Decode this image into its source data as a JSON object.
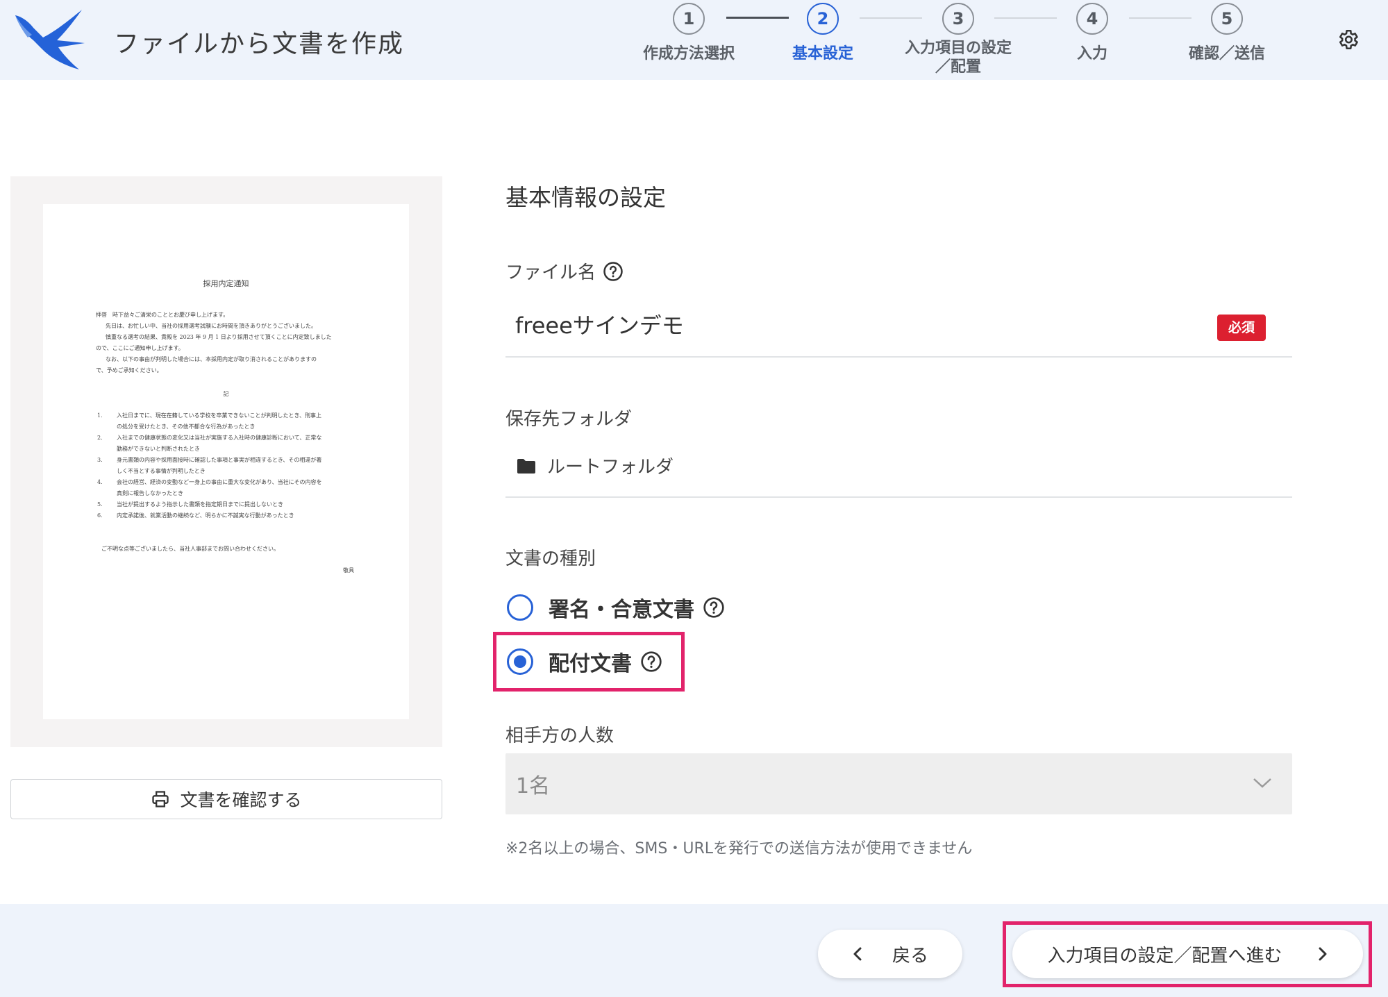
{
  "header": {
    "app_title": "ファイルから文書を作成",
    "steps": [
      {
        "number": "1",
        "label": "作成方法選択",
        "state": "done"
      },
      {
        "number": "2",
        "label": "基本設定",
        "state": "active"
      },
      {
        "number": "3",
        "label_line1": "入力項目の設定",
        "label_line2": "／配置",
        "state": "pending"
      },
      {
        "number": "4",
        "label": "入力",
        "state": "pending"
      },
      {
        "number": "5",
        "label": "確認／送信",
        "state": "pending"
      }
    ],
    "settings_icon": "gear-icon"
  },
  "preview": {
    "document": {
      "title": "採用内定通知",
      "body_lines": [
        "拝啓　時下益々ご清栄のこととお慶び申し上げます。",
        "先日は、お忙しい中、当社の採用選考試験にお時間を頂きありがとうございました。",
        "慎重なる選考の結果、貴殿を 2023 年 9 月 1 日より採用させて頂くことに内定致しました",
        "ので、ここにご通知申し上げます。",
        "なお、以下の事由が判明した場合には、本採用内定が取り消されることがありますの",
        "で、予めご承知ください。"
      ],
      "center_mark": "記",
      "items": [
        {
          "num": "1.",
          "lines": [
            "入社日までに、現在在籍している学校を卒業できないことが判明したとき、刑事上",
            "の処分を受けたとき、その他不都合な行為があったとき"
          ]
        },
        {
          "num": "2.",
          "lines": [
            "入社までの健康状態の変化又は当社が実施する入社時の健康診断において、正常な",
            "勤務ができないと判断されたとき"
          ]
        },
        {
          "num": "3.",
          "lines": [
            "身元書類の内容や採用面接時に確認した事項と事実が相違するとき、その相違が著",
            "しく不当とする事情が判明したとき"
          ]
        },
        {
          "num": "4.",
          "lines": [
            "会社の経営、経済の変動など一身上の事由に重大な変化があり、当社にその内容を",
            "真剣に報告しなかったとき"
          ]
        },
        {
          "num": "5.",
          "lines": [
            "当社が提出するよう指示した書類を指定期日までに提出しないとき"
          ]
        },
        {
          "num": "6.",
          "lines": [
            "内定承諾後、就業活動の継続など、明らかに不誠実な行動があったとき"
          ]
        }
      ],
      "closing": "ご不明な点等ございましたら、当社人事部までお問い合わせください。",
      "signature": "敬具"
    },
    "confirm_button": "文書を確認する",
    "confirm_icon": "printer-icon"
  },
  "form": {
    "section_title": "基本情報の設定",
    "filename": {
      "label": "ファイル名",
      "value": "freeeサインデモ",
      "required_badge": "必須"
    },
    "folder": {
      "label": "保存先フォルダ",
      "value": "ルートフォルダ",
      "icon": "folder-icon"
    },
    "doc_type": {
      "label": "文書の種別",
      "options": [
        {
          "label": "署名・合意文書",
          "selected": false
        },
        {
          "label": "配付文書",
          "selected": true
        }
      ]
    },
    "counterparty": {
      "label": "相手方の人数",
      "value": "1名",
      "note": "※2名以上の場合、SMS・URLを発行での送信方法が使用できません"
    }
  },
  "footer": {
    "back_button": "戻る",
    "next_button": "入力項目の設定／配置へ進む"
  },
  "colors": {
    "accent": "#2862d6",
    "highlight": "#e2236b",
    "required": "#dc2030",
    "header_bg": "#eef3fb"
  }
}
